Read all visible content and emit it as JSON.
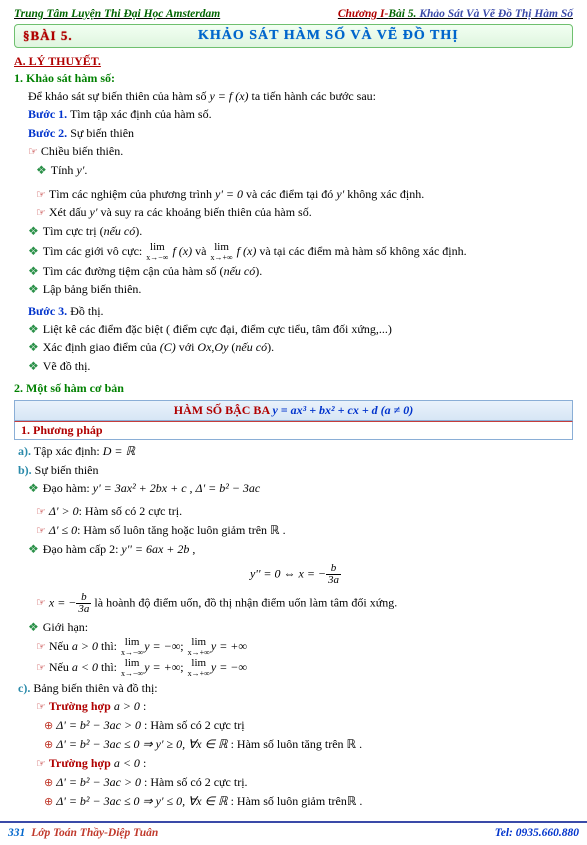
{
  "header": {
    "left": "Trung Tâm Luyện Thi Đại Học Amsterdam",
    "chapter": "Chương I-",
    "bai": "Bài 5.",
    "rest": " Khảo Sát Và Vẽ Đồ Thị Hàm Số"
  },
  "banner": {
    "left": "§BÀI 5.",
    "center": "KHẢO SÁT HÀM SỐ VÀ VẼ ĐỒ THỊ"
  },
  "section_a": "A. LÝ THUYẾT.",
  "sub1": "1. Khảo sát hàm số:",
  "intro1": "Để khảo sát sự biến thiên của hàm số ",
  "intro_fx": "y = f (x)",
  "intro2": " ta tiến hành các bước sau:",
  "b1_label": "Bước 1.",
  "b1_text": " Tìm tập xác định của hàm số.",
  "b2_label": "Bước 2.",
  "b2_text": " Sự biến thiên",
  "cbt": "Chiều biến thiên.",
  "tinh_y": "Tính ",
  "yv": "y'",
  "dot": ".",
  "tim_nghiem1": "Tìm các nghiệm của phương trình ",
  "yeq0": "y' = 0",
  "tim_nghiem2": " và các điểm tại đó ",
  "tim_nghiem3": " không xác định.",
  "xetdau": "Xét dấu ",
  "xetdau2": " và suy ra các khoảng biến thiên của hàm số.",
  "cuctri": "Tìm cực trị (",
  "neuco": "nếu có",
  "cp": ").",
  "gioi_vocuc1": "Tìm các giới vô cực: ",
  "gioi_vocuc2": " và ",
  "gioi_vocuc3": " và tại các điểm mà hàm số không xác định.",
  "lim_fx": "f (x)",
  "tiemcan": "Tìm các đường tiệm cận của hàm số (",
  "lapbang": "Lập bảng biến thiên.",
  "b3_label": "Bước 3.",
  "b3_text": " Đồ thị.",
  "lietke": "Liệt kê các điểm đặc biệt ( điểm cực đại, điểm cực tiểu, tâm đối xứng,...)",
  "xacdinh": "Xác định giao điểm của ",
  "C": "(C)",
  "voi": " với ",
  "ox": "Ox",
  "comma": ",",
  "oy": "Oy",
  "lparen": " (",
  "vedothi": "Vẽ đồ thị.",
  "sub2": "2. Một số hàm cơ bản",
  "banner2_label": "HÀM SỐ BẬC BA",
  "banner2_eq": "y = ax³ + bx² + cx + d    (a ≠ 0)",
  "phuongphap": "1.  Phương pháp",
  "a_label": "a).",
  "a_text": " Tập xác định: ",
  "DR": "D = ℝ",
  "b_label": "b).",
  "b_text": " Sự biến thiên",
  "daoham_lbl": "Đạo hàm: ",
  "daoham_eq": "y' = 3ax² + 2bx + c ,  Δ' = b² − 3ac",
  "dgt0": "Δ' > 0",
  "dgt0_t": ": Hàm số có 2 cực trị.",
  "dle0": "Δ' ≤ 0",
  "dle0_t": ": Hàm số luôn tăng hoặc luôn giảm trên ",
  "RR": "ℝ",
  "dhc2_lbl": "Đạo hàm cấp 2: ",
  "dhc2_eq": "y'' = 6ax + 2b",
  "ce_left": "y'' = 0 ⇔ x = −",
  "ce_num": "b",
  "ce_den": "3a",
  "uon_pre": "x = −",
  "uon_post": " là hoành độ điểm uốn, đồ thị nhận điểm uốn làm tâm đối xứng.",
  "gioihan": "Giới hạn:",
  "neu": "Nếu ",
  "a_gt0": "a > 0",
  "thi": " thì: ",
  "col_sc": "; ",
  "lim_ninf": "x→−∞",
  "lim_pinf": "x→+∞",
  "lim_y": "y",
  "eq_ninf": " = −∞",
  "eq_pinf": " = +∞",
  "a_lt0": "a < 0",
  "c_label": "c).",
  "c_text": " Bảng biến thiên và đồ thị:",
  "th_label": "Trường hợp ",
  "colon": " :",
  "case_gt0": "Δ' = b² − 3ac > 0",
  "case_gt0_t": " : Hàm số có 2 cực trị",
  "case_le0_a": "Δ' = b² − 3ac ≤ 0 ⇒ y' ≥ 0, ∀x ∈ ℝ",
  "case_le0_a_t": " : Hàm số luôn tăng trên ",
  "case_gt0b_t": " : Hàm số có 2 cực trị.",
  "case_le0_b": "Δ' = b² − 3ac ≤ 0 ⇒ y' ≤ 0, ∀x ∈ ℝ",
  "case_le0_b_t": " : Hàm số luôn giảm trên",
  "footer": {
    "page": "331",
    "mid": "Lớp Toán Thầy-Diệp Tuân",
    "tel": "Tel: 0935.660.880"
  },
  "lim_word": "lim"
}
